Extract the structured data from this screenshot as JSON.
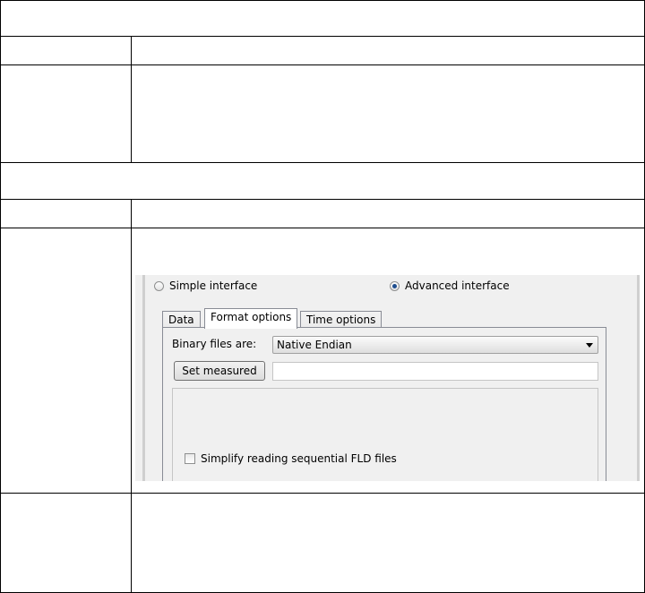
{
  "document": {
    "rows": [
      {
        "type": "full",
        "text": ""
      },
      {
        "type": "split",
        "left": "",
        "right": ""
      },
      {
        "type": "split",
        "left": "",
        "right": ""
      },
      {
        "type": "full",
        "text": ""
      },
      {
        "type": "split",
        "left": "",
        "right": ""
      },
      {
        "type": "split",
        "left": "",
        "right": ""
      },
      {
        "type": "split",
        "left": "",
        "right": ""
      }
    ]
  },
  "screenshot": {
    "radio_simple": {
      "label": "Simple interface",
      "checked": false
    },
    "radio_advanced": {
      "label": "Advanced interface",
      "checked": true
    },
    "tabs": [
      {
        "label": "Data",
        "active": false
      },
      {
        "label": "Format options",
        "active": true
      },
      {
        "label": "Time options",
        "active": false
      }
    ],
    "binary_label": "Binary files are:",
    "binary_select_value": "Native Endian",
    "set_measured_button": "Set measured",
    "measured_input_value": "",
    "simplify_checkbox": {
      "label": "Simplify reading sequential FLD files",
      "checked": false
    }
  }
}
